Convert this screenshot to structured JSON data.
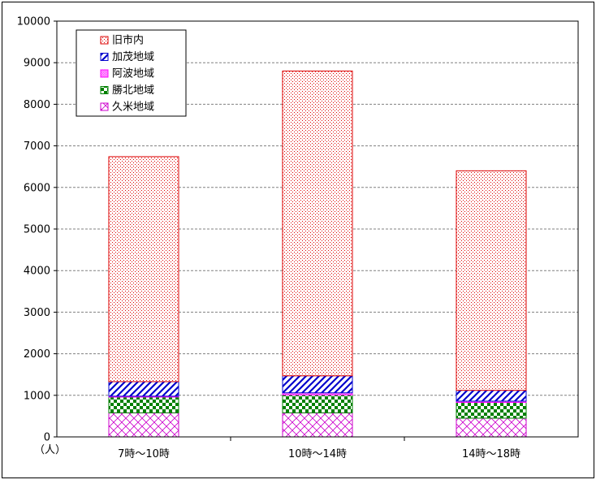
{
  "chart_data": {
    "type": "bar",
    "stacked": true,
    "unit_label": "（人）",
    "categories": [
      "7時～10時",
      "10時～14時",
      "14時～18時"
    ],
    "ylim": [
      0,
      10000
    ],
    "yticks": [
      0,
      1000,
      2000,
      3000,
      4000,
      5000,
      6000,
      7000,
      8000,
      9000,
      10000
    ],
    "grid": true,
    "legend_position": "top-left",
    "series": [
      {
        "name": "久米地域",
        "values": [
          580,
          580,
          450
        ],
        "color": "#cc00cc",
        "pattern": "crosshatch"
      },
      {
        "name": "勝北地域",
        "values": [
          380,
          430,
          380
        ],
        "color": "#008000",
        "pattern": "checker"
      },
      {
        "name": "阿波地域",
        "values": [
          20,
          50,
          30
        ],
        "color": "#ff00ff",
        "pattern": "fine-checker"
      },
      {
        "name": "加茂地域",
        "values": [
          350,
          410,
          260
        ],
        "color": "#0000cc",
        "pattern": "diagonal"
      },
      {
        "name": "旧市内",
        "values": [
          5410,
          7330,
          5280
        ],
        "color": "#dd0000",
        "pattern": "dots"
      }
    ]
  }
}
